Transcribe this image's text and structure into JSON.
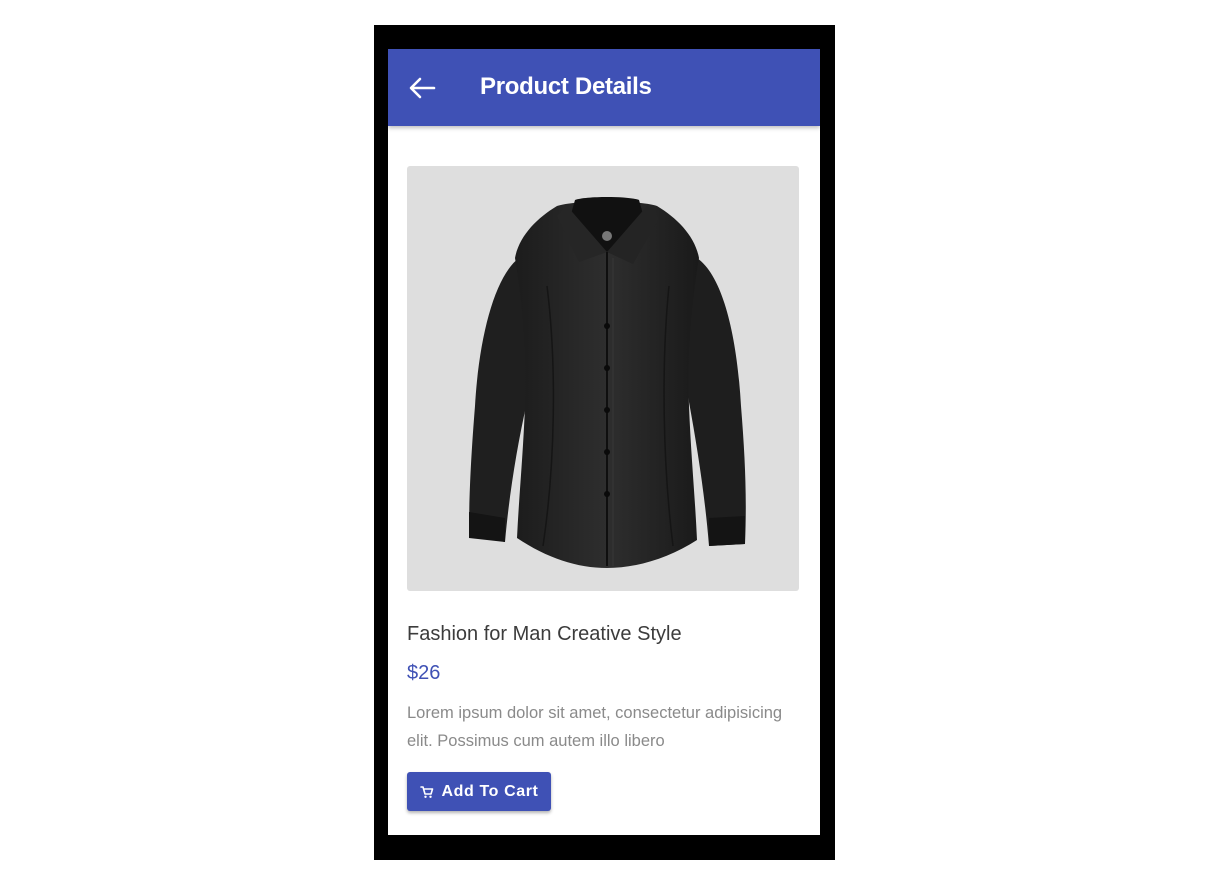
{
  "header": {
    "title": "Product Details",
    "back_icon": "arrow-left-icon",
    "background_color": "#3f51b5"
  },
  "product": {
    "image_alt": "black long-sleeve button-up shirt",
    "name": "Fashion for Man Creative Style",
    "price": "$26",
    "description": "Lorem ipsum dolor sit amet, consectetur adipisicing elit. Possimus cum autem illo libero"
  },
  "actions": {
    "add_to_cart_label": "Add To Cart",
    "cart_icon": "cart-icon"
  },
  "colors": {
    "accent": "#3f51b5",
    "image_background": "#dedede"
  }
}
